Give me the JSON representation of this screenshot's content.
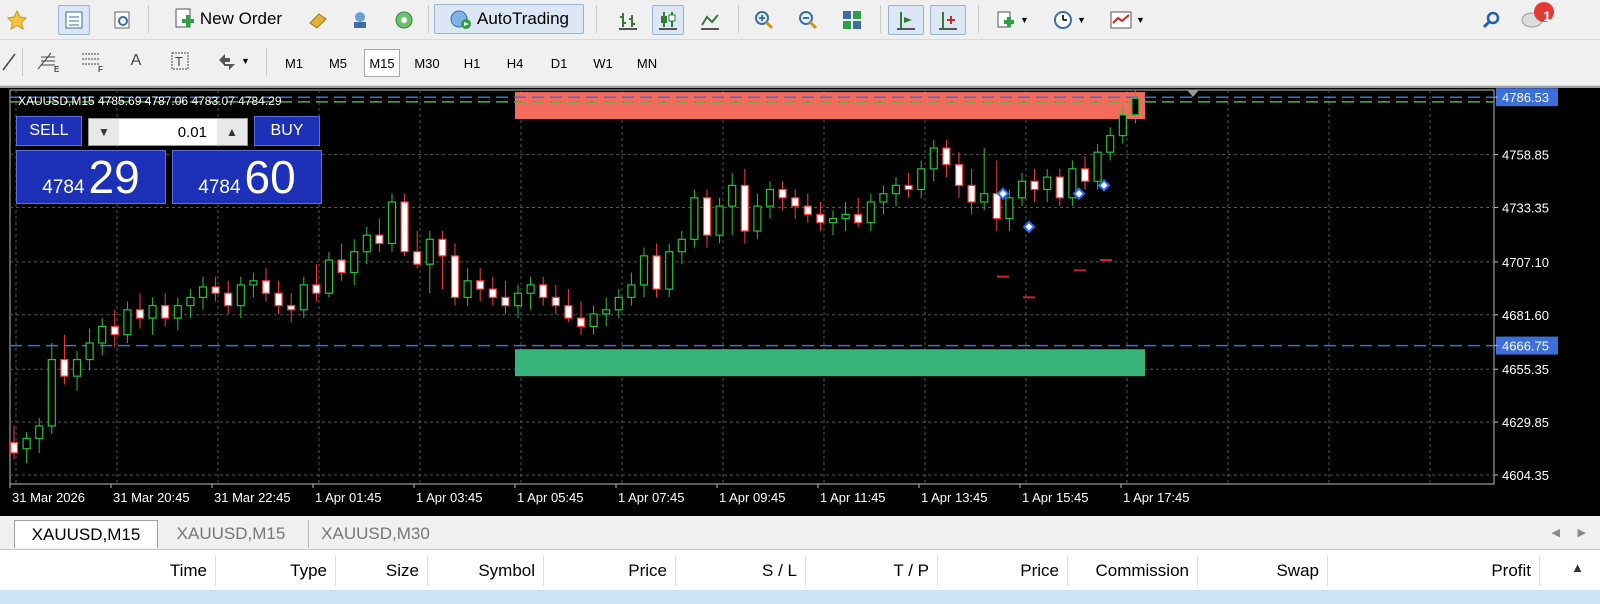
{
  "toolbar": {
    "new_order": "New Order",
    "auto_trading": "AutoTrading",
    "notification_count": "1"
  },
  "timeframes": [
    "M1",
    "M5",
    "M15",
    "M30",
    "H1",
    "H4",
    "D1",
    "W1",
    "MN"
  ],
  "active_timeframe": "M15",
  "chart": {
    "header": "XAUUSD,M15  4785.69 4787.06 4783.07 4784.29",
    "sell_label": "SELL",
    "buy_label": "BUY",
    "lot": "0.01",
    "sell_price_small": "4784",
    "sell_price_big": "29",
    "buy_price_small": "4784",
    "buy_price_big": "60",
    "price_labels": [
      "4786.53",
      "4758.85",
      "4733.35",
      "4707.10",
      "4681.60",
      "4666.75",
      "4655.35",
      "4629.85",
      "4604.35"
    ],
    "highlight_prices": [
      "4786.53",
      "4666.75"
    ],
    "time_labels": [
      "31 Mar 2026",
      "31 Mar 20:45",
      "31 Mar 22:45",
      "1 Apr 01:45",
      "1 Apr 03:45",
      "1 Apr 05:45",
      "1 Apr 07:45",
      "1 Apr 09:45",
      "1 Apr 11:45",
      "1 Apr 13:45",
      "1 Apr 15:45",
      "1 Apr 17:45"
    ],
    "candles_ohlc": [
      [
        4620,
        4628,
        4612,
        4615
      ],
      [
        4617,
        4625,
        4610,
        4622
      ],
      [
        4622,
        4632,
        4615,
        4628
      ],
      [
        4628,
        4668,
        4624,
        4660
      ],
      [
        4660,
        4672,
        4648,
        4652
      ],
      [
        4652,
        4664,
        4645,
        4660
      ],
      [
        4660,
        4675,
        4655,
        4668
      ],
      [
        4668,
        4680,
        4662,
        4676
      ],
      [
        4676,
        4684,
        4666,
        4672
      ],
      [
        4672,
        4688,
        4668,
        4684
      ],
      [
        4684,
        4692,
        4675,
        4680
      ],
      [
        4680,
        4690,
        4672,
        4686
      ],
      [
        4686,
        4692,
        4676,
        4680
      ],
      [
        4680,
        4690,
        4674,
        4686
      ],
      [
        4686,
        4694,
        4680,
        4690
      ],
      [
        4690,
        4700,
        4684,
        4695
      ],
      [
        4695,
        4700,
        4688,
        4692
      ],
      [
        4692,
        4698,
        4682,
        4686
      ],
      [
        4686,
        4700,
        4680,
        4696
      ],
      [
        4696,
        4702,
        4690,
        4698
      ],
      [
        4698,
        4704,
        4688,
        4692
      ],
      [
        4692,
        4698,
        4682,
        4686
      ],
      [
        4686,
        4692,
        4678,
        4684
      ],
      [
        4684,
        4700,
        4680,
        4696
      ],
      [
        4696,
        4706,
        4688,
        4692
      ],
      [
        4692,
        4712,
        4690,
        4708
      ],
      [
        4708,
        4716,
        4698,
        4702
      ],
      [
        4702,
        4718,
        4696,
        4712
      ],
      [
        4712,
        4724,
        4706,
        4720
      ],
      [
        4720,
        4728,
        4712,
        4716
      ],
      [
        4716,
        4740,
        4712,
        4736
      ],
      [
        4736,
        4740,
        4710,
        4712
      ],
      [
        4712,
        4722,
        4704,
        4706
      ],
      [
        4706,
        4722,
        4692,
        4718
      ],
      [
        4718,
        4722,
        4694,
        4710
      ],
      [
        4710,
        4716,
        4686,
        4690
      ],
      [
        4690,
        4704,
        4686,
        4698
      ],
      [
        4698,
        4704,
        4688,
        4694
      ],
      [
        4694,
        4700,
        4686,
        4690
      ],
      [
        4690,
        4698,
        4682,
        4686
      ],
      [
        4686,
        4696,
        4680,
        4692
      ],
      [
        4692,
        4700,
        4684,
        4696
      ],
      [
        4696,
        4700,
        4686,
        4690
      ],
      [
        4690,
        4696,
        4682,
        4686
      ],
      [
        4686,
        4694,
        4678,
        4680
      ],
      [
        4680,
        4688,
        4672,
        4676
      ],
      [
        4676,
        4686,
        4672,
        4682
      ],
      [
        4682,
        4690,
        4676,
        4684
      ],
      [
        4684,
        4694,
        4680,
        4690
      ],
      [
        4690,
        4702,
        4686,
        4696
      ],
      [
        4696,
        4714,
        4690,
        4710
      ],
      [
        4710,
        4716,
        4690,
        4694
      ],
      [
        4694,
        4716,
        4690,
        4712
      ],
      [
        4712,
        4722,
        4706,
        4718
      ],
      [
        4718,
        4742,
        4714,
        4738
      ],
      [
        4738,
        4742,
        4714,
        4720
      ],
      [
        4720,
        4738,
        4716,
        4734
      ],
      [
        4734,
        4750,
        4720,
        4744
      ],
      [
        4744,
        4752,
        4716,
        4722
      ],
      [
        4722,
        4740,
        4718,
        4734
      ],
      [
        4734,
        4746,
        4728,
        4742
      ],
      [
        4742,
        4746,
        4732,
        4738
      ],
      [
        4738,
        4742,
        4728,
        4734
      ],
      [
        4734,
        4740,
        4726,
        4730
      ],
      [
        4730,
        4736,
        4722,
        4726
      ],
      [
        4726,
        4732,
        4720,
        4728
      ],
      [
        4728,
        4736,
        4722,
        4730
      ],
      [
        4730,
        4738,
        4724,
        4726
      ],
      [
        4726,
        4740,
        4722,
        4736
      ],
      [
        4736,
        4744,
        4730,
        4740
      ],
      [
        4740,
        4748,
        4734,
        4744
      ],
      [
        4744,
        4750,
        4738,
        4742
      ],
      [
        4742,
        4756,
        4738,
        4752
      ],
      [
        4752,
        4766,
        4746,
        4762
      ],
      [
        4762,
        4766,
        4748,
        4754
      ],
      [
        4754,
        4760,
        4738,
        4744
      ],
      [
        4744,
        4752,
        4730,
        4736
      ],
      [
        4736,
        4762,
        4732,
        4740
      ],
      [
        4740,
        4756,
        4722,
        4728
      ],
      [
        4728,
        4742,
        4722,
        4738
      ],
      [
        4738,
        4750,
        4734,
        4746
      ],
      [
        4746,
        4752,
        4736,
        4742
      ],
      [
        4742,
        4752,
        4736,
        4748
      ],
      [
        4748,
        4752,
        4734,
        4738
      ],
      [
        4738,
        4756,
        4734,
        4752
      ],
      [
        4752,
        4758,
        4742,
        4746
      ],
      [
        4746,
        4764,
        4742,
        4760
      ],
      [
        4760,
        4772,
        4756,
        4768
      ],
      [
        4768,
        4782,
        4764,
        4778
      ],
      [
        4778,
        4790,
        4774,
        4786
      ]
    ]
  },
  "tabs": [
    "XAUUSD,M15",
    "XAUUSD,M15",
    "XAUUSD,M30"
  ],
  "terminal_columns": [
    "Time",
    "Type",
    "Size",
    "Symbol",
    "Price",
    "S / L",
    "T / P",
    "Price",
    "Commission",
    "Swap",
    "Profit"
  ]
}
